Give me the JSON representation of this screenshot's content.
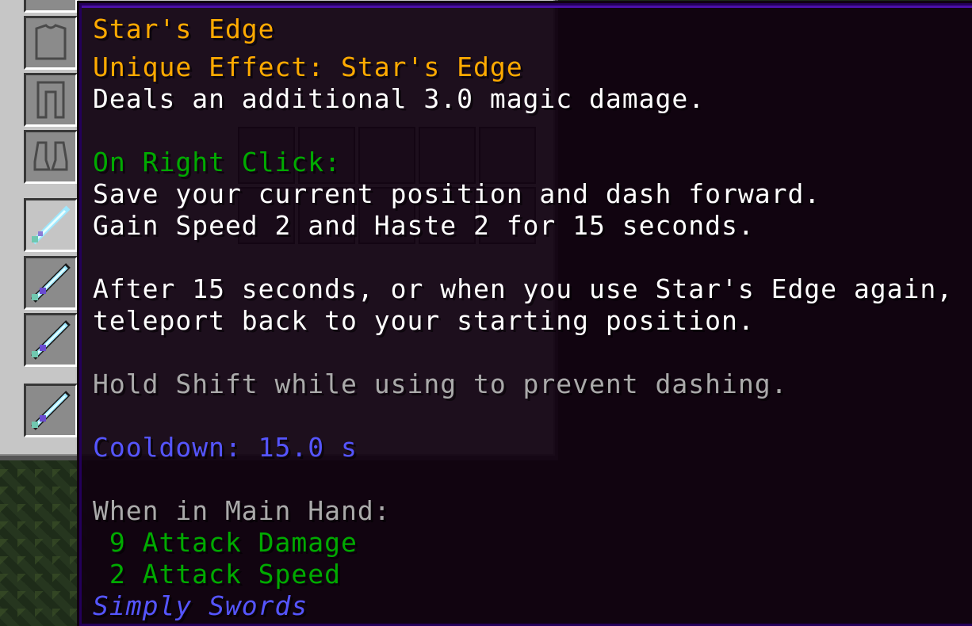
{
  "tooltip": {
    "title": "Star's Edge",
    "unique_effect": "Unique Effect: Star's Edge",
    "effect_desc": "Deals an additional 3.0 magic damage.",
    "right_click_header": "On Right Click:",
    "right_click_line1": "Save your current position and dash forward.",
    "right_click_line2": "Gain Speed 2 and Haste 2 for 15 seconds.",
    "after_line1": "After 15 seconds, or when you use Star's Edge again,",
    "after_line2": "teleport back to your starting position.",
    "shift_hint": "Hold Shift while using to prevent dashing.",
    "cooldown": "Cooldown: 15.0 s",
    "main_hand_header": "When in Main Hand:",
    "attack_damage": " 9 Attack Damage",
    "attack_speed": " 2 Attack Speed",
    "mod_name": "Simply Swords"
  },
  "colors": {
    "title": "#ffaa00",
    "description": "#ffffff",
    "ability": "#00aa00",
    "hint": "#aaaaaa",
    "cooldown": "#5555ff",
    "mod": "#5555ff"
  },
  "inventory": {
    "armor_slots": [
      "helmet-slot-icon",
      "chestplate-slot-icon",
      "leggings-slot-icon",
      "boots-slot-icon"
    ],
    "item_slots": [
      "stars-edge-sword-icon",
      "stars-edge-sword-icon",
      "stars-edge-sword-icon",
      "stars-edge-sword-icon"
    ]
  }
}
